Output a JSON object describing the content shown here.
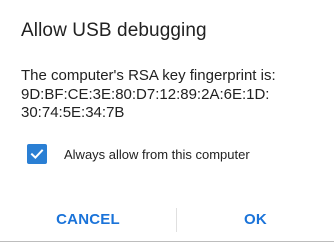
{
  "dialog": {
    "title": "Allow USB debugging",
    "message_lines": [
      "The computer's RSA key fingerprint is:",
      "9D:BF:CE:3E:80:D7:12:89:2A:6E:1D:",
      "30:74:5E:34:7B"
    ],
    "checkbox": {
      "label": "Always allow from this computer",
      "checked": true,
      "icon": "checkmark-icon"
    },
    "buttons": {
      "cancel": "CANCEL",
      "ok": "OK"
    },
    "colors": {
      "accent": "#1a73d9",
      "checkbox_fill": "#2a7fd4",
      "text": "#212121"
    }
  }
}
